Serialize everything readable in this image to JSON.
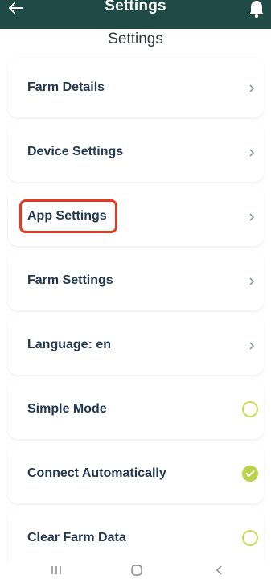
{
  "app_bar": {
    "title": "Settings",
    "icons": {
      "back": "back-arrow-icon",
      "notification": "bell-icon"
    },
    "background": "#1f4a46"
  },
  "page": {
    "title": "Settings"
  },
  "settings": [
    {
      "label": "Farm Details",
      "control": "chevron"
    },
    {
      "label": "Device Settings",
      "control": "chevron"
    },
    {
      "label": "App Settings",
      "control": "chevron",
      "highlighted": true
    },
    {
      "label": "Farm Settings",
      "control": "chevron"
    },
    {
      "label": "Language: en",
      "control": "chevron"
    },
    {
      "label": "Simple Mode",
      "control": "radio",
      "checked": false
    },
    {
      "label": "Connect Automatically",
      "control": "radio",
      "checked": true
    },
    {
      "label": "Clear Farm Data",
      "control": "radio",
      "checked": false
    }
  ],
  "colors": {
    "accent": "#b9d44c",
    "highlight": "#e53a22",
    "label": "#243a52"
  },
  "system_nav": {
    "icons": [
      "recent-apps-icon",
      "home-icon",
      "back-icon"
    ]
  }
}
